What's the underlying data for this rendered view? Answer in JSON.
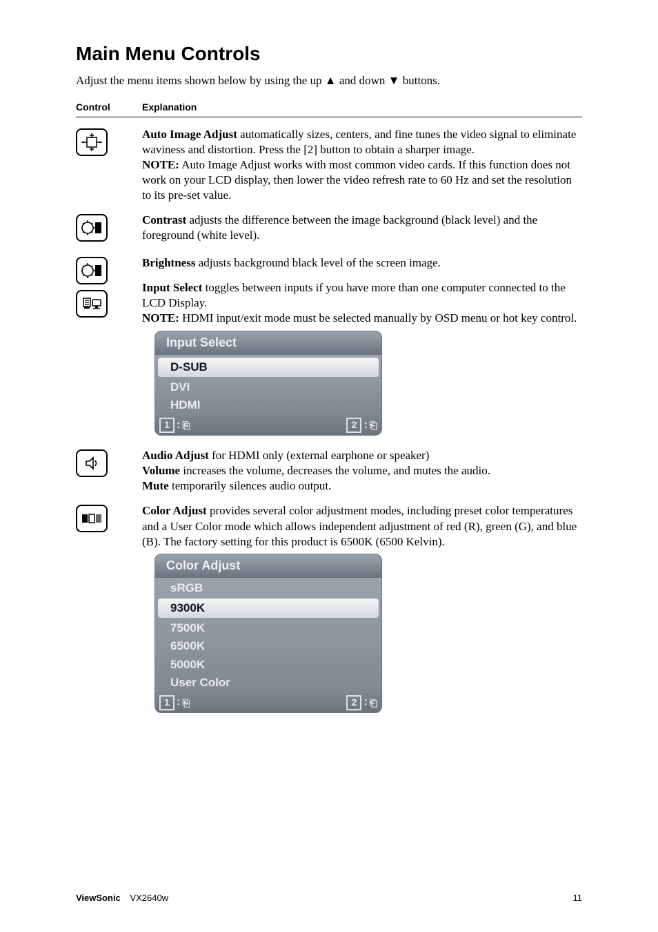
{
  "title": "Main Menu Controls",
  "intro": "Adjust the menu items shown below by using the up ▲ and down ▼ buttons.",
  "headers": {
    "control": "Control",
    "explanation": "Explanation"
  },
  "auto_image_adjust": {
    "label": "Auto Image Adjust",
    "text": " automatically sizes, centers, and fine tunes the video signal to eliminate waviness and distortion. Press the [2] button to obtain a sharper image.",
    "note_label": "NOTE:",
    "note_text": " Auto Image Adjust works with most common video cards. If this function does not work on your LCD display, then lower the video refresh rate to 60 Hz and set the resolution to its pre-set value."
  },
  "contrast": {
    "label": "Contrast",
    "text": " adjusts the difference between the image background  (black level) and the foreground (white level)."
  },
  "brightness": {
    "label": "Brightness",
    "text": " adjusts background black level of the screen image."
  },
  "input_select": {
    "label": "Input Select",
    "text": " toggles between inputs if you have more than one computer connected to the LCD Display.",
    "note_label": "NOTE:",
    "note_text": " HDMI input/exit mode must be selected manually by OSD menu or hot key control."
  },
  "audio_adjust": {
    "label": "Audio Adjust",
    "text": " for HDMI only (external earphone or speaker)",
    "volume_label": "Volume",
    "volume_text": " increases the volume, decreases the volume, and mutes the audio.",
    "mute_label": "Mute",
    "mute_text": " temporarily silences audio output."
  },
  "color_adjust": {
    "label": "Color Adjust",
    "text": " provides several color adjustment modes, including preset color temperatures and a User Color mode which allows independent adjustment of red (R), green (G), and blue (B). The factory setting for this product is 6500K (6500 Kelvin)."
  },
  "osd_input": {
    "title": "Input Select",
    "items": [
      "D-SUB",
      "DVI",
      "HDMI"
    ],
    "selected_index": 0,
    "footer_key1": "1",
    "footer_key2": "2"
  },
  "osd_color": {
    "title": "Color Adjust",
    "items": [
      "sRGB",
      "9300K",
      "7500K",
      "6500K",
      "5000K",
      "User Color"
    ],
    "selected_index": 1,
    "footer_key1": "1",
    "footer_key2": "2"
  },
  "footer": {
    "brand": "ViewSonic",
    "model": "VX2640w",
    "page": "11"
  }
}
